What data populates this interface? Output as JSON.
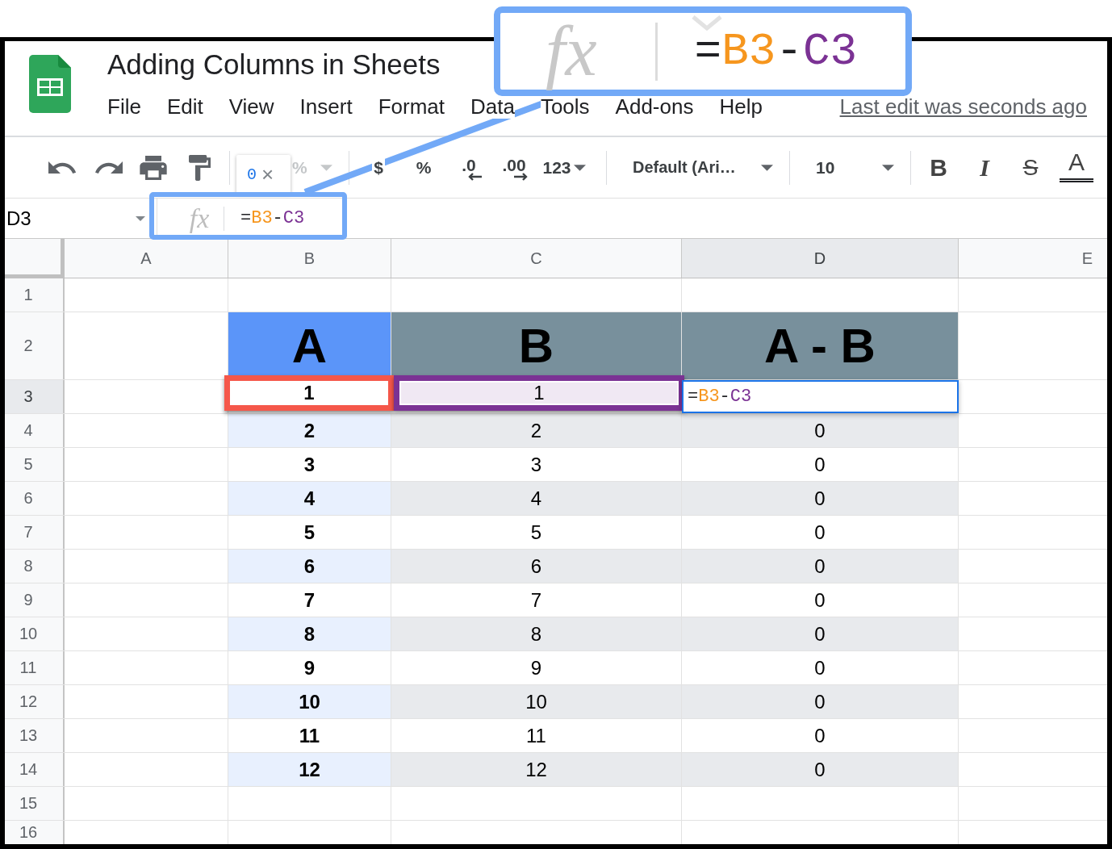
{
  "callout": {
    "function_label": "fx",
    "formula": [
      {
        "text": "="
      },
      {
        "text": "B3",
        "color": "#f6961e"
      },
      {
        "text": "-"
      },
      {
        "text": "C3",
        "color": "#7b3294"
      }
    ]
  },
  "document": {
    "title": "Adding Columns in Sheets"
  },
  "menu": [
    "File",
    "Edit",
    "View",
    "Insert",
    "Format",
    "Data",
    "Tools",
    "Add-ons",
    "Help"
  ],
  "last_edit": "Last edit was seconds ago",
  "toolbar": {
    "zoom": "%",
    "format_buttons": [
      {
        "label": "$",
        "kind": "plain"
      },
      {
        "label": "%",
        "kind": "plain"
      },
      {
        "label": ".0",
        "kind": "decrease"
      },
      {
        "label": ".00",
        "kind": "increase"
      },
      {
        "label": "123",
        "kind": "menu"
      }
    ],
    "font": "Default (Ari…",
    "font_size": "10",
    "style_buttons": [
      {
        "label": "B",
        "kind": "bold"
      },
      {
        "label": "I",
        "kind": "italic"
      },
      {
        "label": "S",
        "kind": "strikethrough"
      },
      {
        "label": "A",
        "kind": "text_color"
      }
    ]
  },
  "result_tooltip": {
    "value": "0",
    "close": "×"
  },
  "formula_bar": {
    "name_box": "D3",
    "function_label": "fx",
    "formula": [
      {
        "text": "="
      },
      {
        "text": "B3",
        "color": "#f6961e"
      },
      {
        "text": "-"
      },
      {
        "text": "C3",
        "color": "#7b3294"
      }
    ]
  },
  "sheet": {
    "columns": [
      {
        "label": "A",
        "selected": false
      },
      {
        "label": "B",
        "selected": false
      },
      {
        "label": "C",
        "selected": false
      },
      {
        "label": "D",
        "selected": true
      },
      {
        "label": "E",
        "selected": false
      }
    ],
    "rows": [
      {
        "number": "1",
        "selected": false,
        "kind": "blank"
      },
      {
        "number": "2",
        "selected": false,
        "kind": "title",
        "cells": {
          "b": {
            "text": "A",
            "color": "#5b95f9"
          },
          "c": {
            "text": "B",
            "color": "#78909c"
          },
          "d": {
            "text": "A - B",
            "color": "#78909c"
          }
        }
      },
      {
        "number": "3",
        "selected": true,
        "kind": "edit",
        "cells": {
          "b": {
            "text": "1",
            "color": "#f5574a",
            "tinted": false
          },
          "c": {
            "text": "1",
            "color": "#7b3294",
            "tinted": true
          },
          "d": {
            "formula": [
              {
                "text": "="
              },
              {
                "text": "B3",
                "color": "#f6961e"
              },
              {
                "text": "-"
              },
              {
                "text": "C3",
                "color": "#7b3294"
              }
            ]
          }
        }
      },
      {
        "number": "4",
        "selected": false,
        "kind": "data",
        "shaded": true,
        "cells": {
          "b": "2",
          "c": "2",
          "d": "0"
        }
      },
      {
        "number": "5",
        "selected": false,
        "kind": "data",
        "shaded": false,
        "cells": {
          "b": "3",
          "c": "3",
          "d": "0"
        }
      },
      {
        "number": "6",
        "selected": false,
        "kind": "data",
        "shaded": true,
        "cells": {
          "b": "4",
          "c": "4",
          "d": "0"
        }
      },
      {
        "number": "7",
        "selected": false,
        "kind": "data",
        "shaded": false,
        "cells": {
          "b": "5",
          "c": "5",
          "d": "0"
        }
      },
      {
        "number": "8",
        "selected": false,
        "kind": "data",
        "shaded": true,
        "cells": {
          "b": "6",
          "c": "6",
          "d": "0"
        }
      },
      {
        "number": "9",
        "selected": false,
        "kind": "data",
        "shaded": false,
        "cells": {
          "b": "7",
          "c": "7",
          "d": "0"
        }
      },
      {
        "number": "10",
        "selected": false,
        "kind": "data",
        "shaded": true,
        "cells": {
          "b": "8",
          "c": "8",
          "d": "0"
        }
      },
      {
        "number": "11",
        "selected": false,
        "kind": "data",
        "shaded": false,
        "cells": {
          "b": "9",
          "c": "9",
          "d": "0"
        }
      },
      {
        "number": "12",
        "selected": false,
        "kind": "data",
        "shaded": true,
        "cells": {
          "b": "10",
          "c": "10",
          "d": "0"
        }
      },
      {
        "number": "13",
        "selected": false,
        "kind": "data",
        "shaded": false,
        "cells": {
          "b": "11",
          "c": "11",
          "d": "0"
        }
      },
      {
        "number": "14",
        "selected": false,
        "kind": "data",
        "shaded": true,
        "cells": {
          "b": "12",
          "c": "12",
          "d": "0"
        }
      },
      {
        "number": "15",
        "selected": false,
        "kind": "blank"
      },
      {
        "number": "16",
        "selected": false,
        "kind": "blank"
      }
    ]
  }
}
